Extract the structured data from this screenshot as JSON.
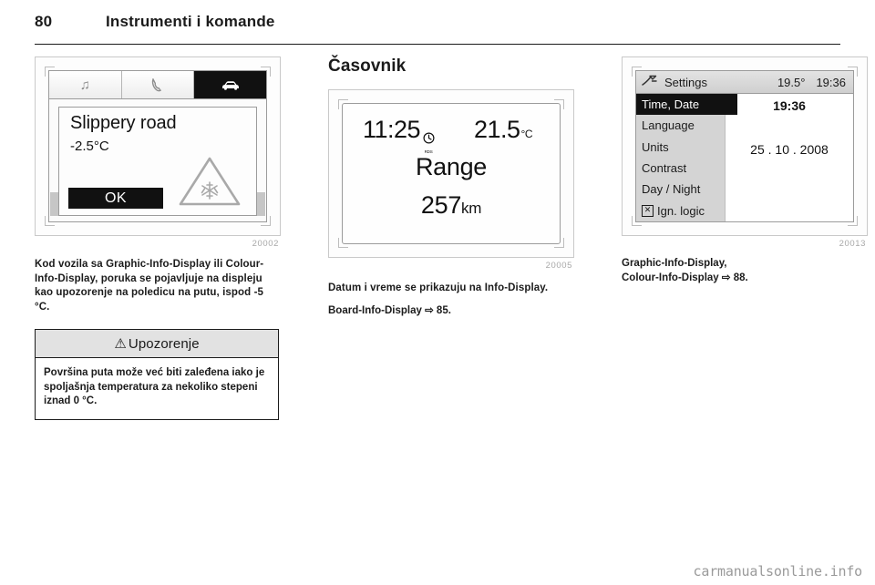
{
  "header": {
    "page_number": "80",
    "chapter": "Instrumenti i komande"
  },
  "columns": {
    "left": {
      "figure": {
        "number": "20002",
        "display": {
          "tabs": [
            {
              "icon": "music-note-icon",
              "glyph": "♫",
              "active": false
            },
            {
              "icon": "phone-handset-icon",
              "glyph": "",
              "active": false
            },
            {
              "icon": "car-icon",
              "glyph": "",
              "active": true
            }
          ],
          "message_title": "Slippery road",
          "message_temp": "-2.5°C",
          "ok_label": "OK",
          "warning_icon": "snowflake-triangle-icon"
        }
      },
      "body_text": "Kod vozila sa Graphic-Info-Display ili Colour-Info-Display, poruka se pojavljuje na displeju kao upozorenje na poledicu na putu, ispod -5 °C.",
      "warning": {
        "icon": "warning-triangle-icon",
        "glyph": "⚠",
        "title": "Upozorenje",
        "body": "Površina puta može već biti zaleđena iako je spoljašnja temperatura za nekoliko stepeni iznad 0 °C."
      }
    },
    "middle": {
      "section_title": "Časovnik",
      "figure": {
        "number": "20005",
        "display": {
          "clock": "11:25",
          "rds_icon": "clock-rds-icon",
          "rds_label": "RDS",
          "temperature": "21.5",
          "temperature_unit": "°C",
          "range_label": "Range",
          "range_value": "257",
          "range_unit": "km"
        }
      },
      "body_text": "Datum i vreme se prikazuju na Info-Display.",
      "reference": {
        "label": "Board-Info-Display",
        "arrow": "⇨",
        "page": "85."
      }
    },
    "right": {
      "figure": {
        "number": "20013",
        "display": {
          "header": {
            "icon": "settings-tool-icon",
            "title": "Settings",
            "temperature": "19.5°",
            "time": "19:36"
          },
          "menu_items": [
            {
              "label": "Time, Date",
              "selected": true,
              "checkbox": false
            },
            {
              "label": "Language",
              "selected": false,
              "checkbox": false
            },
            {
              "label": "Units",
              "selected": false,
              "checkbox": false
            },
            {
              "label": "Contrast",
              "selected": false,
              "checkbox": false
            },
            {
              "label": "Day / Night",
              "selected": false,
              "checkbox": false
            },
            {
              "label": "Ign. logic",
              "selected": false,
              "checkbox": true,
              "checkbox_glyph": "✕"
            }
          ],
          "value_time": "19:36",
          "value_date": "25 . 10 . 2008"
        }
      },
      "reference": {
        "line1": "Graphic-Info-Display,",
        "label": "Colour-Info-Display",
        "arrow": "⇨",
        "page": "88."
      }
    }
  },
  "watermark": "carmanualsonline.info"
}
